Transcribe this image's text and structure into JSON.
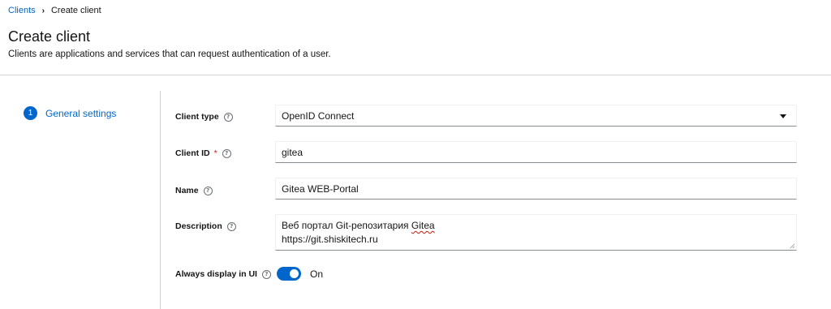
{
  "breadcrumb": {
    "parent": "Clients",
    "current": "Create client"
  },
  "page": {
    "title": "Create client",
    "subtitle": "Clients are applications and services that can request authentication of a user."
  },
  "wizard": {
    "steps": [
      {
        "number": "1",
        "label": "General settings"
      }
    ]
  },
  "form": {
    "client_type": {
      "label": "Client type",
      "value": "OpenID Connect"
    },
    "client_id": {
      "label": "Client ID",
      "required_mark": "*",
      "value": "gitea"
    },
    "name": {
      "label": "Name",
      "value": "Gitea WEB-Portal"
    },
    "description": {
      "label": "Description",
      "line1_prefix": "Веб портал Git-репозитария ",
      "line1_misspelled": "Gitea",
      "line2": "https://git.shiskitech.ru"
    },
    "always_display": {
      "label": "Always display in UI",
      "state_text": "On",
      "checked": true
    }
  },
  "colors": {
    "accent": "#0066cc",
    "required": "#c9190b"
  }
}
